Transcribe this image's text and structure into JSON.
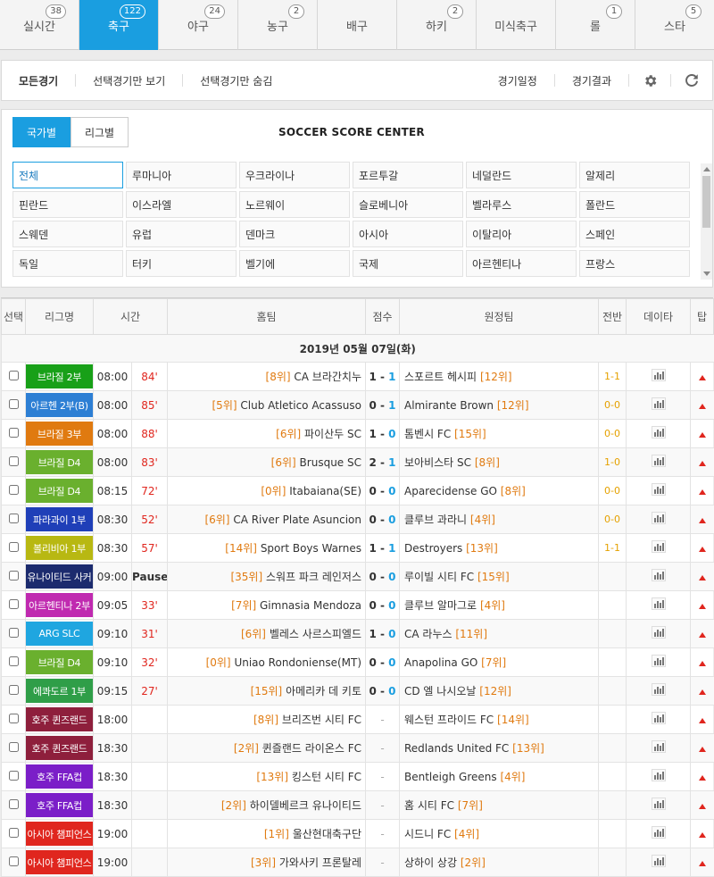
{
  "tabs": [
    {
      "label": "실시간",
      "count": "38",
      "active": false
    },
    {
      "label": "축구",
      "count": "122",
      "active": true
    },
    {
      "label": "야구",
      "count": "24",
      "active": false
    },
    {
      "label": "농구",
      "count": "2",
      "active": false
    },
    {
      "label": "배구",
      "count": "",
      "active": false
    },
    {
      "label": "하키",
      "count": "2",
      "active": false
    },
    {
      "label": "미식축구",
      "count": "",
      "active": false
    },
    {
      "label": "롤",
      "count": "1",
      "active": false
    },
    {
      "label": "스타",
      "count": "5",
      "active": false
    }
  ],
  "filterbar": {
    "all": "모든경기",
    "show_selected": "선택경기만 보기",
    "hide_selected": "선택경기만 숨김",
    "schedule": "경기일정",
    "results": "경기결과"
  },
  "country": {
    "tab_country": "국가별",
    "tab_league": "리그별",
    "title": "SOCCER SCORE CENTER",
    "items": [
      "전체",
      "루마니아",
      "우크라이나",
      "포르투갈",
      "네덜란드",
      "알제리",
      "핀란드",
      "이스라엘",
      "노르웨이",
      "슬로베니아",
      "벨라루스",
      "폴란드",
      "스웨덴",
      "유럽",
      "덴마크",
      "아시아",
      "이탈리아",
      "스페인",
      "독일",
      "터키",
      "벨기에",
      "국제",
      "아르헨티나",
      "프랑스"
    ]
  },
  "table": {
    "headers": {
      "select": "선택",
      "league": "리그명",
      "time": "시간",
      "home": "홈팀",
      "score": "점수",
      "away": "원정팀",
      "half": "전반",
      "data": "데이타",
      "tip": "탑"
    },
    "date": "2019년 05월 07일(화)",
    "rows": [
      {
        "league": "브라질 2부",
        "league_color": "#18a018",
        "time": "08:00",
        "minute": "84'",
        "home_rank": "[8위]",
        "home": "CA 브라간치누",
        "score_home": "1",
        "score_away": "1",
        "away": "스포르트 헤시피",
        "away_rank": "[12위]",
        "half": "1-1"
      },
      {
        "league": "아르헨 2부(B)",
        "league_color": "#2d7fd4",
        "time": "08:00",
        "minute": "85'",
        "home_rank": "[5위]",
        "home": "Club Atletico Acassuso",
        "score_home": "0",
        "score_away": "1",
        "away": "Almirante Brown",
        "away_rank": "[12위]",
        "half": "0-0"
      },
      {
        "league": "브라질 3부",
        "league_color": "#e07a10",
        "time": "08:00",
        "minute": "88'",
        "home_rank": "[6위]",
        "home": "파이산두 SC",
        "score_home": "1",
        "score_away": "0",
        "away": "톰벤시 FC",
        "away_rank": "[15위]",
        "half": "0-0"
      },
      {
        "league": "브라질 D4",
        "league_color": "#6ab02e",
        "time": "08:00",
        "minute": "83'",
        "home_rank": "[6위]",
        "home": "Brusque SC",
        "score_home": "2",
        "score_away": "1",
        "away": "보아비스타 SC",
        "away_rank": "[8위]",
        "half": "1-0"
      },
      {
        "league": "브라질 D4",
        "league_color": "#6ab02e",
        "time": "08:15",
        "minute": "72'",
        "home_rank": "[0위]",
        "home": "Itabaiana(SE)",
        "score_home": "0",
        "score_away": "0",
        "away": "Aparecidense GO",
        "away_rank": "[8위]",
        "half": "0-0"
      },
      {
        "league": "파라과이 1부",
        "league_color": "#1f3fb8",
        "time": "08:30",
        "minute": "52'",
        "home_rank": "[6위]",
        "home": "CA River Plate Asuncion",
        "score_home": "0",
        "score_away": "0",
        "away": "클루브 과라니",
        "away_rank": "[4위]",
        "half": "0-0"
      },
      {
        "league": "볼리비아 1부",
        "league_color": "#b8b812",
        "time": "08:30",
        "minute": "57'",
        "home_rank": "[14위]",
        "home": "Sport Boys Warnes",
        "score_home": "1",
        "score_away": "1",
        "away": "Destroyers",
        "away_rank": "[13위]",
        "half": "1-1"
      },
      {
        "league": "유나이티드 사커",
        "league_color": "#1c2b6e",
        "time": "09:00",
        "minute": "Pause",
        "home_rank": "[35위]",
        "home": "스워프 파크 레인저스",
        "score_home": "0",
        "score_away": "0",
        "away": "루이빌 시티 FC",
        "away_rank": "[15위]",
        "half": ""
      },
      {
        "league": "아르헨티나 2부",
        "league_color": "#c02ab0",
        "time": "09:05",
        "minute": "33'",
        "home_rank": "[7위]",
        "home": "Gimnasia Mendoza",
        "score_home": "0",
        "score_away": "0",
        "away": "클루브 알마그로",
        "away_rank": "[4위]",
        "half": ""
      },
      {
        "league": "ARG SLC",
        "league_color": "#1fa6e0",
        "time": "09:10",
        "minute": "31'",
        "home_rank": "[6위]",
        "home": "벨레스 사르스피엘드",
        "score_home": "1",
        "score_away": "0",
        "away": "CA 라누스",
        "away_rank": "[11위]",
        "half": ""
      },
      {
        "league": "브라질 D4",
        "league_color": "#6ab02e",
        "time": "09:10",
        "minute": "32'",
        "home_rank": "[0위]",
        "home": "Uniao Rondoniense(MT)",
        "score_home": "0",
        "score_away": "0",
        "away": "Anapolina GO",
        "away_rank": "[7위]",
        "half": ""
      },
      {
        "league": "에콰도르 1부",
        "league_color": "#2f9e48",
        "time": "09:15",
        "minute": "27'",
        "home_rank": "[15위]",
        "home": "아메리카 데 키토",
        "score_home": "0",
        "score_away": "0",
        "away": "CD 엘 나시오날",
        "away_rank": "[12위]",
        "half": ""
      },
      {
        "league": "호주 퀸즈랜드",
        "league_color": "#8e1f3c",
        "time": "18:00",
        "minute": "",
        "home_rank": "[8위]",
        "home": "브리즈번 시티 FC",
        "score_home": "",
        "score_away": "",
        "away": "웨스턴 프라이드 FC",
        "away_rank": "[14위]",
        "half": ""
      },
      {
        "league": "호주 퀸즈랜드",
        "league_color": "#8e1f3c",
        "time": "18:30",
        "minute": "",
        "home_rank": "[2위]",
        "home": "퀸즐랜드 라이온스 FC",
        "score_home": "",
        "score_away": "",
        "away": "Redlands United FC",
        "away_rank": "[13위]",
        "half": ""
      },
      {
        "league": "호주 FFA컵",
        "league_color": "#7b1ec8",
        "time": "18:30",
        "minute": "",
        "home_rank": "[13위]",
        "home": "킹스턴 시티 FC",
        "score_home": "",
        "score_away": "",
        "away": "Bentleigh Greens",
        "away_rank": "[4위]",
        "half": ""
      },
      {
        "league": "호주 FFA컵",
        "league_color": "#7b1ec8",
        "time": "18:30",
        "minute": "",
        "home_rank": "[2위]",
        "home": "하이델베르크 유나이티드",
        "score_home": "",
        "score_away": "",
        "away": "홈 시티 FC",
        "away_rank": "[7위]",
        "half": ""
      },
      {
        "league": "아시아 챔피언스",
        "league_color": "#e0261e",
        "time": "19:00",
        "minute": "",
        "home_rank": "[1위]",
        "home": "울산현대축구단",
        "score_home": "",
        "score_away": "",
        "away": "시드니 FC",
        "away_rank": "[4위]",
        "half": ""
      },
      {
        "league": "아시아 챔피언스",
        "league_color": "#e0261e",
        "time": "19:00",
        "minute": "",
        "home_rank": "[3위]",
        "home": "가와사키 프론탈레",
        "score_home": "",
        "score_away": "",
        "away": "상하이 상강",
        "away_rank": "[2위]",
        "half": ""
      }
    ]
  }
}
